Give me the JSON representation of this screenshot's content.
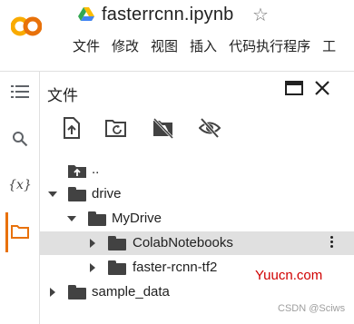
{
  "header": {
    "logo_text": "CO",
    "notebook_title": "fasterrcnn.ipynb",
    "icons": {
      "drive": "google-drive-icon",
      "star": "star-outline-icon"
    },
    "menu": [
      "文件",
      "修改",
      "视图",
      "插入",
      "代码执行程序",
      "工"
    ]
  },
  "rail": {
    "icons": [
      "table-of-contents-icon",
      "search-icon",
      "variables-icon",
      "files-folder-icon"
    ],
    "variables_label": "{x}",
    "active": "files-folder-icon"
  },
  "panel": {
    "title": "文件",
    "header_icons": [
      "maximize-icon",
      "close-icon"
    ],
    "toolbar_icons": [
      "upload-file-icon",
      "refresh-folder-icon",
      "mount-drive-off-icon",
      "hide-hidden-files-icon"
    ]
  },
  "tree": {
    "up": {
      "label": ".."
    },
    "drive": {
      "label": "drive",
      "expanded": true
    },
    "mydrive": {
      "label": "MyDrive",
      "expanded": true
    },
    "colab": {
      "label": "ColabNotebooks",
      "expanded": false,
      "selected": true
    },
    "fastertf2": {
      "label": "faster-rcnn-tf2",
      "expanded": false
    },
    "sample": {
      "label": "sample_data",
      "expanded": false
    }
  },
  "watermarks": {
    "site": "Yuucn.com",
    "csdn": "CSDN @Sciws"
  },
  "colors": {
    "accent_orange": "#e8710a",
    "logo_orange": "#f9ab00",
    "selected_row": "#e0e0e0"
  }
}
